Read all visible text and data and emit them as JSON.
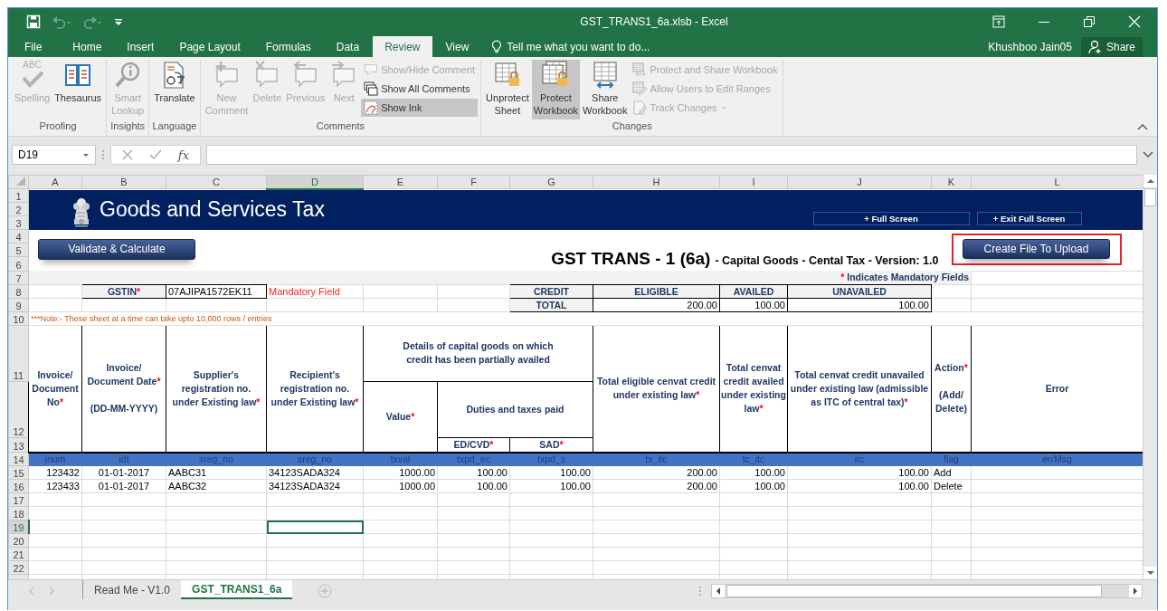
{
  "window": {
    "title": "GST_TRANS1_6a.xlsb - Excel"
  },
  "quick_access": [
    {
      "kind": "save",
      "disabled": false
    },
    {
      "kind": "undo",
      "disabled": true
    },
    {
      "kind": "redo",
      "disabled": true
    },
    {
      "kind": "customize",
      "disabled": false
    }
  ],
  "menu_tabs": [
    {
      "label": "File",
      "selected": false
    },
    {
      "label": "Home",
      "selected": false
    },
    {
      "label": "Insert",
      "selected": false
    },
    {
      "label": "Page Layout",
      "selected": false
    },
    {
      "label": "Formulas",
      "selected": false
    },
    {
      "label": "Data",
      "selected": false
    },
    {
      "label": "Review",
      "selected": true
    },
    {
      "label": "View",
      "selected": false
    }
  ],
  "tell_me": {
    "label": "Tell me what you want to do..."
  },
  "user": "Khushboo Jain05",
  "share": "Share",
  "ribbon_groups": [
    {
      "title": "Proofing",
      "commands": [
        {
          "label": "Spelling",
          "kind": "large",
          "icon_text": "ABC",
          "disabled": true,
          "on": false
        },
        {
          "label": "Thesaurus",
          "kind": "large",
          "disabled": false,
          "on": false
        }
      ]
    },
    {
      "title": "Insights",
      "commands": [
        {
          "label": "Smart Lookup",
          "kind": "large",
          "disabled": true,
          "on": false
        }
      ]
    },
    {
      "title": "Language",
      "commands": [
        {
          "label": "Translate",
          "kind": "large",
          "disabled": false,
          "on": false
        }
      ]
    },
    {
      "title": "Comments",
      "commands": [
        {
          "label": "New Comment",
          "kind": "large",
          "disabled": true,
          "on": false
        },
        {
          "label": "Delete",
          "kind": "large",
          "disabled": true,
          "on": false
        },
        {
          "label": "Previous",
          "kind": "large",
          "disabled": true,
          "on": false
        },
        {
          "label": "Next",
          "kind": "large",
          "disabled": true,
          "on": false
        },
        {
          "label": "Show/Hide Comment",
          "kind": "small",
          "disabled": true,
          "on": false,
          "dropdown": false
        },
        {
          "label": "Show All Comments",
          "kind": "small",
          "disabled": false,
          "on": false,
          "dropdown": false
        },
        {
          "label": "Show Ink",
          "kind": "small",
          "disabled": false,
          "on": true,
          "dropdown": false
        }
      ]
    },
    {
      "title": "Changes",
      "commands": [
        {
          "label": "Unprotect Sheet",
          "kind": "large",
          "disabled": false,
          "on": false
        },
        {
          "label": "Protect Workbook",
          "kind": "large",
          "disabled": false,
          "on": true
        },
        {
          "label": "Share Workbook",
          "kind": "large",
          "disabled": false,
          "on": false
        },
        {
          "label": "Protect and Share Workbook",
          "kind": "small",
          "disabled": true,
          "on": false,
          "dropdown": false
        },
        {
          "label": "Allow Users to Edit Ranges",
          "kind": "small",
          "disabled": true,
          "on": false,
          "dropdown": false
        },
        {
          "label": "Track Changes",
          "kind": "small",
          "disabled": true,
          "on": false,
          "dropdown": true
        }
      ]
    }
  ],
  "formula_bar": {
    "name_box": "D19",
    "insert_function": "fx"
  },
  "sheet": {
    "columns": [
      {
        "label": "A",
        "selected": false
      },
      {
        "label": "B",
        "selected": false
      },
      {
        "label": "C",
        "selected": false
      },
      {
        "label": "D",
        "selected": true
      },
      {
        "label": "E",
        "selected": false
      },
      {
        "label": "F",
        "selected": false
      },
      {
        "label": "G",
        "selected": false
      },
      {
        "label": "H",
        "selected": false
      },
      {
        "label": "I",
        "selected": false
      },
      {
        "label": "J",
        "selected": false
      },
      {
        "label": "K",
        "selected": false
      },
      {
        "label": "L",
        "selected": false
      }
    ],
    "row_headers": [
      {
        "label": "1",
        "selected": false
      },
      {
        "label": "2",
        "selected": false
      },
      {
        "label": "3",
        "selected": false
      },
      {
        "label": "4",
        "selected": false
      },
      {
        "label": "5",
        "selected": false
      },
      {
        "label": "6",
        "selected": false
      },
      {
        "label": "7",
        "selected": false
      },
      {
        "label": "8",
        "selected": false
      },
      {
        "label": "9",
        "selected": false
      },
      {
        "label": "10",
        "selected": false
      },
      {
        "label": "11",
        "selected": false
      },
      {
        "label": "12",
        "selected": false
      },
      {
        "label": "13",
        "selected": false
      },
      {
        "label": "14",
        "selected": false
      },
      {
        "label": "15",
        "selected": false
      },
      {
        "label": "16",
        "selected": false
      },
      {
        "label": "17",
        "selected": false
      },
      {
        "label": "18",
        "selected": false
      },
      {
        "label": "19",
        "selected": true
      },
      {
        "label": "20",
        "selected": false
      },
      {
        "label": "21",
        "selected": false
      },
      {
        "label": "22",
        "selected": false
      }
    ],
    "banner": {
      "title": "Goods and Services Tax",
      "buttons": [
        "+ Full Screen",
        "+ Exit Full Screen"
      ]
    },
    "validate_button": "Validate & Calculate",
    "heading": {
      "title": "GST TRANS - 1 (6a)",
      "subtitle": "- Capital Goods - Cental Tax - Version: 1.0"
    },
    "upload_button": {
      "label": "Create File To Upload",
      "highlighted": true
    },
    "mandatory_legend": {
      "mark": "*",
      "text": "Indicates Mandatory Fields"
    },
    "gstin": {
      "label": "GSTIN",
      "mark": "*",
      "value": "07AJIPA1572EK11",
      "hint": "Mandatory Field"
    },
    "credit_summary": {
      "headers": [
        "CREDIT",
        "ELIGIBLE",
        "AVAILED",
        "UNAVAILED"
      ],
      "total_row": [
        "TOTAL",
        "200.00",
        "100.00",
        "100.00"
      ]
    },
    "note": "***Note:- These sheet at a time can take upto 10,000 rows / entries",
    "table": {
      "left_headers": [
        {
          "text": "Invoice/ Document No",
          "mark": "*"
        },
        {
          "text": "Invoice/ Document Date",
          "mark": "*",
          "note": "(DD-MM-YYYY)"
        },
        {
          "text": "Supplier's registration no. under Existing law",
          "mark": "*"
        },
        {
          "text": "Recipient's registration no. under Existing law",
          "mark": "*"
        }
      ],
      "group": {
        "text": "Details of capital goods on which credit has been partially availed",
        "value": {
          "text": "Value",
          "mark": "*"
        },
        "duties": {
          "text": "Duties and taxes paid",
          "columns": [
            {
              "text": "ED/CVD",
              "mark": "*"
            },
            {
              "text": "SAD",
              "mark": "*"
            }
          ]
        }
      },
      "right_headers": [
        {
          "text": "Total eligible cenvat credit under existing law",
          "mark": "*"
        },
        {
          "text": "Total cenvat credit availed under existing law",
          "mark": "*"
        },
        {
          "text": "Total cenvat credit unavailed under existing law (admissible as ITC of central tax)",
          "mark": "*"
        },
        {
          "text": "Action",
          "mark": "*",
          "note": "(Add/ Delete)"
        },
        {
          "text": "Error"
        }
      ],
      "field_codes": [
        "inum",
        "idt",
        "sreg_no",
        "sreg_no",
        "txval",
        "txpd_ec",
        "txpd_s",
        "tx_itc",
        "tc_itc",
        "itc",
        "flag",
        "errMsg"
      ],
      "rows": [
        {
          "cells": [
            "123432",
            "01-01-2017",
            "AABC31",
            "34123SADA324",
            "1000.00",
            "100.00",
            "100.00",
            "200.00",
            "100.00",
            "100.00",
            "Add"
          ]
        },
        {
          "cells": [
            "123433",
            "01-01-2017",
            "AABC32",
            "34123SADA324",
            "1000.00",
            "100.00",
            "100.00",
            "200.00",
            "100.00",
            "100.00",
            "Delete"
          ]
        }
      ]
    }
  },
  "sheet_tabs": [
    {
      "label": "Read Me - V1.0",
      "selected": false
    },
    {
      "label": "GST_TRANS1_6a",
      "selected": true
    }
  ]
}
